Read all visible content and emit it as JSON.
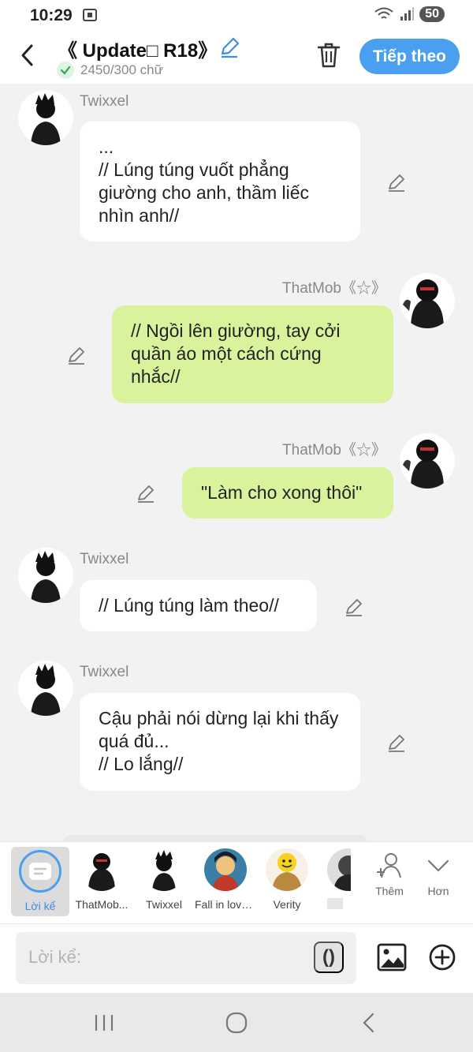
{
  "status_bar": {
    "time": "10:29",
    "battery": "50"
  },
  "header": {
    "title": "《 Update□ R18》",
    "word_count": "2450/300 chữ",
    "next_label": "Tiếp theo"
  },
  "messages": [
    {
      "side": "left",
      "sender": "Twixxel",
      "text": "...\n// Lúng túng vuốt phẳng giường cho anh, thầm liếc nhìn anh//"
    },
    {
      "side": "right",
      "sender": "ThatMob《☆》",
      "text": "// Ngồi lên giường, tay cởi quần áo một cách cứng nhắc//"
    },
    {
      "side": "right",
      "sender": "ThatMob《☆》",
      "text": "\"Làm cho xong thôi\""
    },
    {
      "side": "left",
      "sender": "Twixxel",
      "text": "// Lúng túng làm theo//"
    },
    {
      "side": "left",
      "sender": "Twixxel",
      "text": "Cậu phải nói dừng lại khi thấy quá đủ...\n// Lo lắng//"
    }
  ],
  "characters": [
    {
      "name": "Lời kể",
      "icon": "narration-icon",
      "active": true
    },
    {
      "name": "ThatMob...",
      "icon": "avatar-thatmob"
    },
    {
      "name": "Twixxel",
      "icon": "avatar-twixxel"
    },
    {
      "name": "Fall in love...",
      "icon": "avatar-fall-in-love"
    },
    {
      "name": "Verity",
      "icon": "avatar-verity"
    }
  ],
  "char_actions": {
    "add_label": "Thêm",
    "more_label": "Hơn"
  },
  "input": {
    "placeholder": "Lời kể:",
    "paren_label": "()"
  },
  "colors": {
    "accent": "#4a9ff0",
    "bubble_right": "#d9f39d",
    "bubble_left": "#ffffff",
    "background": "#f2f2f2"
  }
}
